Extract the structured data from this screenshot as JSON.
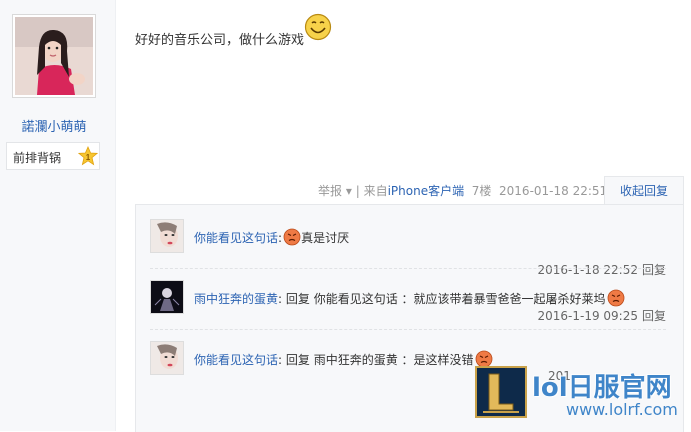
{
  "author": {
    "name": "諾瀾小萌萌",
    "rank_label": "前排背锅",
    "rank_level": "1"
  },
  "post": {
    "text": "好好的音乐公司，做什么游戏",
    "report": "举报",
    "report_arrow": "▾",
    "separator": "|",
    "source": "来自",
    "source_link": "iPhone客户端",
    "floor": "7楼",
    "datetime": "2016-01-18 22:51",
    "collapse_reply": "收起回复"
  },
  "replies": [
    {
      "user": "你能看见这句话",
      "colon": ":",
      "content": "真是讨厌",
      "date": "2016-1-18 22:52",
      "reply_label": "回复"
    },
    {
      "user": "雨中狂奔的蛋黄",
      "colon": ":",
      "content": "回复 你能看见这句话 ：就应该带着暴雪爸爸一起屠杀好莱坞",
      "date": "2016-1-19 09:25",
      "reply_label": "回复"
    },
    {
      "user": "你能看见这句话",
      "colon": ":",
      "content": "回复 雨中狂奔的蛋黄 ：是这样没错",
      "date_partial": "201"
    }
  ],
  "watermark": {
    "title": "lol日服官网",
    "url": "www.lolrf.com"
  },
  "colors": {
    "link": "#2d64b3",
    "watermark": "#3f85c9",
    "panel_bg": "#f7f8fa"
  }
}
